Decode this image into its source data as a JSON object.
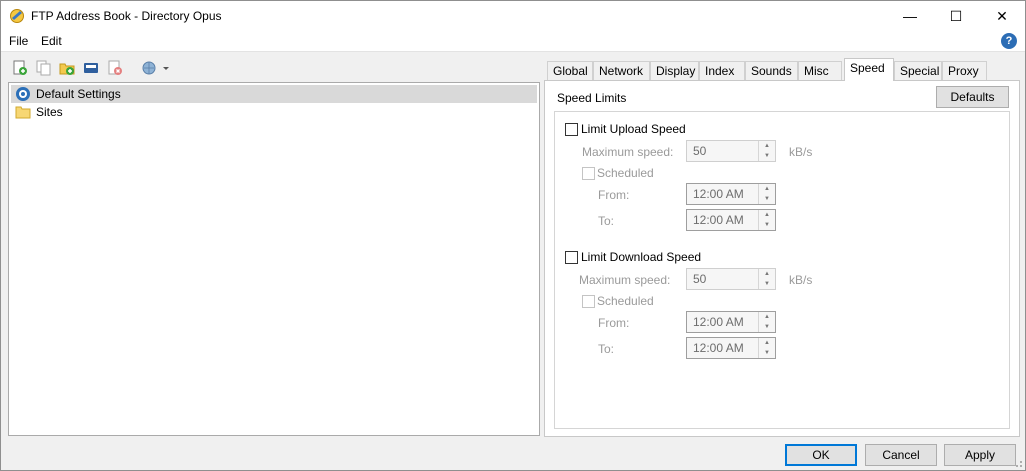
{
  "window": {
    "title": "FTP Address Book - Directory Opus",
    "minimize": "—",
    "maximize": "☐",
    "close": "✕"
  },
  "menu": {
    "items": [
      "File",
      "Edit"
    ],
    "help": "?"
  },
  "toolbar": {
    "icons": [
      "new-entry-icon",
      "copy-entry-icon",
      "new-folder-icon",
      "save-icon",
      "delete-icon",
      "connect-icon"
    ]
  },
  "tree": {
    "items": [
      {
        "label": "Default Settings",
        "icon": "settings-globe-icon",
        "selected": true
      },
      {
        "label": "Sites",
        "icon": "folder-icon",
        "selected": false
      }
    ]
  },
  "tabs": {
    "items": [
      "Global",
      "Network",
      "Display",
      "Index",
      "Sounds",
      "Misc",
      "Speed",
      "Special",
      "Proxy"
    ],
    "active": "Speed"
  },
  "speed": {
    "section_title": "Speed Limits",
    "defaults_label": "Defaults",
    "upload": {
      "label": "Limit Upload Speed",
      "max_label": "Maximum speed:",
      "max_value": "50",
      "unit": "kB/s",
      "scheduled_label": "Scheduled",
      "from_label": "From:",
      "from_value": "12:00 AM",
      "to_label": "To:",
      "to_value": "12:00 AM"
    },
    "download": {
      "label": "Limit Download Speed",
      "max_label": "Maximum speed:",
      "max_value": "50",
      "unit": "kB/s",
      "scheduled_label": "Scheduled",
      "from_label": "From:",
      "from_value": "12:00 AM",
      "to_label": "To:",
      "to_value": "12:00 AM"
    }
  },
  "buttons": {
    "ok": "OK",
    "cancel": "Cancel",
    "apply": "Apply"
  },
  "colors": {
    "accent": "#0078d7",
    "help": "#2c6db5"
  }
}
